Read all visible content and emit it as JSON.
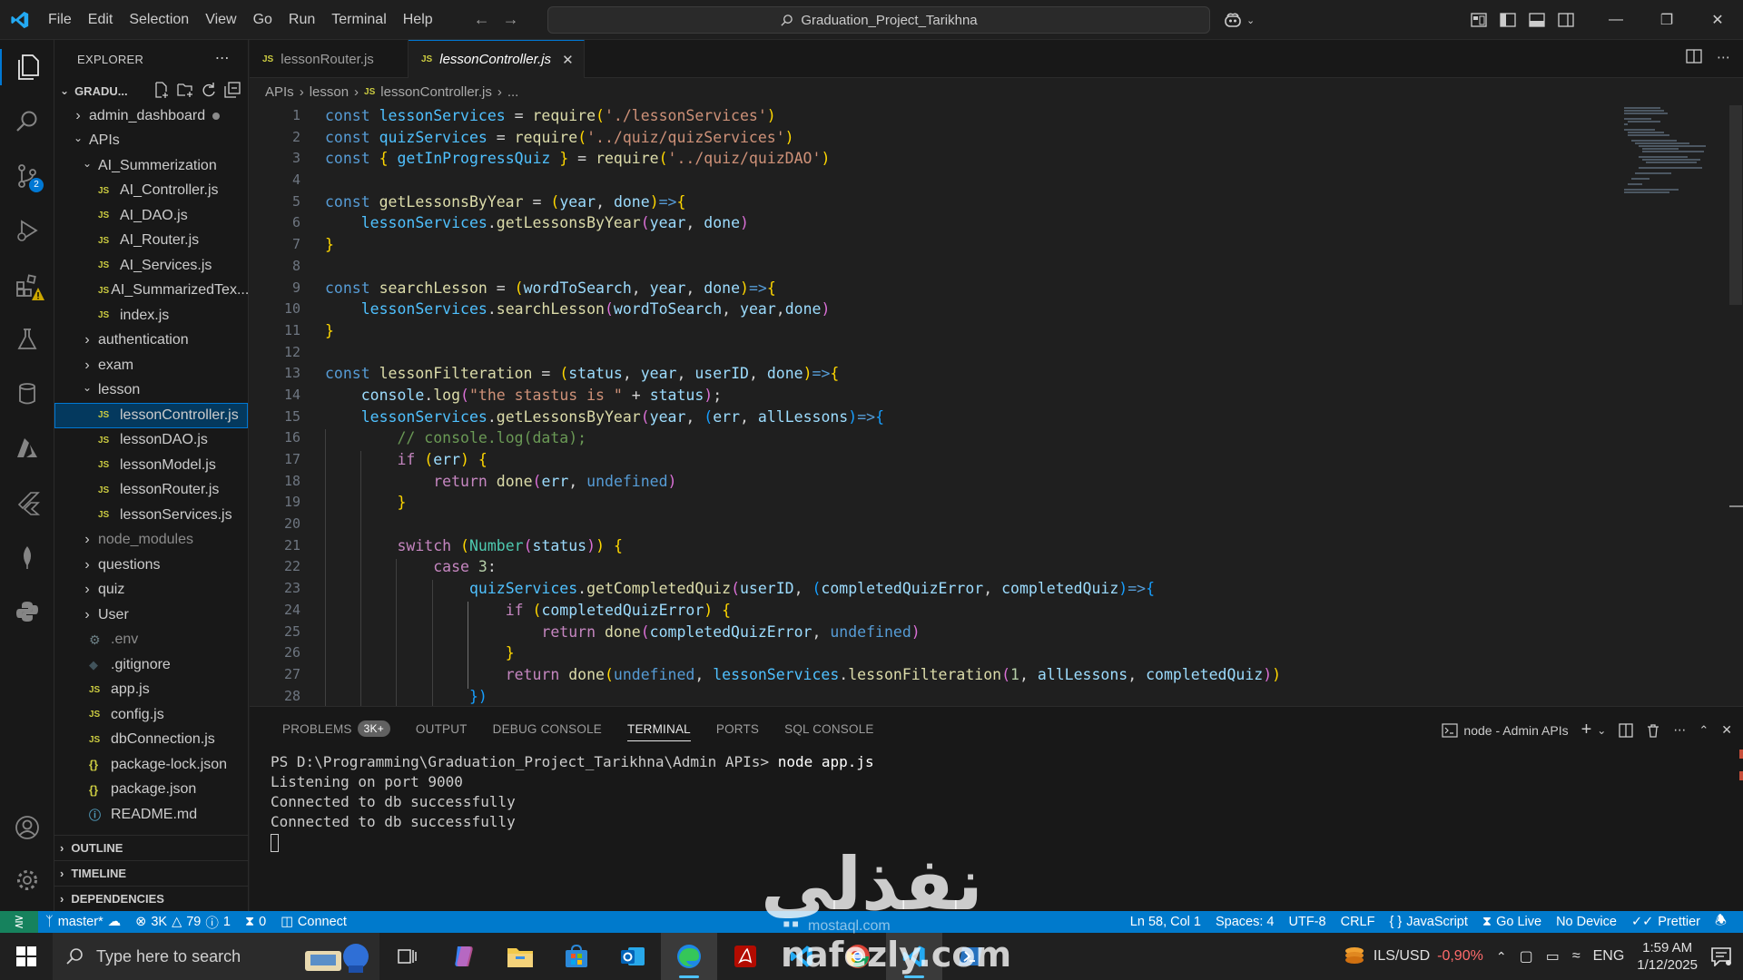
{
  "titlebar": {
    "menu": [
      "File",
      "Edit",
      "Selection",
      "View",
      "Go",
      "Run",
      "Terminal",
      "Help"
    ],
    "search_text": "Graduation_Project_Tarikhna"
  },
  "activity": {
    "source_control_badge": "2"
  },
  "sidebar": {
    "title": "EXPLORER",
    "root": "GRADU...",
    "tree": [
      {
        "label": "admin_dashboard",
        "kind": "folder",
        "depth": 0,
        "open": false,
        "dot": true
      },
      {
        "label": "APIs",
        "kind": "folder",
        "depth": 0,
        "open": true
      },
      {
        "label": "AI_Summerization",
        "kind": "folder",
        "depth": 1,
        "open": true
      },
      {
        "label": "AI_Controller.js",
        "kind": "js",
        "depth": 2
      },
      {
        "label": "AI_DAO.js",
        "kind": "js",
        "depth": 2
      },
      {
        "label": "AI_Router.js",
        "kind": "js",
        "depth": 2
      },
      {
        "label": "AI_Services.js",
        "kind": "js",
        "depth": 2
      },
      {
        "label": "AI_SummarizedTex...",
        "kind": "js",
        "depth": 2
      },
      {
        "label": "index.js",
        "kind": "js",
        "depth": 2
      },
      {
        "label": "authentication",
        "kind": "folder",
        "depth": 1,
        "open": false
      },
      {
        "label": "exam",
        "kind": "folder",
        "depth": 1,
        "open": false
      },
      {
        "label": "lesson",
        "kind": "folder",
        "depth": 1,
        "open": true
      },
      {
        "label": "lessonController.js",
        "kind": "js",
        "depth": 2,
        "selected": true
      },
      {
        "label": "lessonDAO.js",
        "kind": "js",
        "depth": 2
      },
      {
        "label": "lessonModel.js",
        "kind": "js",
        "depth": 2
      },
      {
        "label": "lessonRouter.js",
        "kind": "js",
        "depth": 2
      },
      {
        "label": "lessonServices.js",
        "kind": "js",
        "depth": 2
      },
      {
        "label": "node_modules",
        "kind": "folder",
        "depth": 1,
        "open": false,
        "dim": true
      },
      {
        "label": "questions",
        "kind": "folder",
        "depth": 1,
        "open": false
      },
      {
        "label": "quiz",
        "kind": "folder",
        "depth": 1,
        "open": false
      },
      {
        "label": "User",
        "kind": "folder",
        "depth": 1,
        "open": false
      },
      {
        "label": ".env",
        "kind": "gear",
        "depth": 1,
        "dim": true
      },
      {
        "label": ".gitignore",
        "kind": "git",
        "depth": 1
      },
      {
        "label": "app.js",
        "kind": "js",
        "depth": 1
      },
      {
        "label": "config.js",
        "kind": "js",
        "depth": 1
      },
      {
        "label": "dbConnection.js",
        "kind": "js",
        "depth": 1
      },
      {
        "label": "package-lock.json",
        "kind": "json",
        "depth": 1
      },
      {
        "label": "package.json",
        "kind": "json",
        "depth": 1
      },
      {
        "label": "README.md",
        "kind": "info",
        "depth": 1
      }
    ],
    "sections": [
      "OUTLINE",
      "TIMELINE",
      "DEPENDENCIES"
    ]
  },
  "tabs": [
    {
      "label": "lessonRouter.js",
      "active": false
    },
    {
      "label": "lessonController.js",
      "active": true
    }
  ],
  "breadcrumbs": [
    "APIs",
    "lesson",
    "lessonController.js",
    "..."
  ],
  "editor": {
    "line_numbers": [
      "1",
      "2",
      "3",
      "4",
      "5",
      "6",
      "7",
      "8",
      "9",
      "10",
      "11",
      "12",
      "13",
      "14",
      "15",
      "16",
      "17",
      "18",
      "19",
      "20",
      "21",
      "22",
      "23",
      "24",
      "25",
      "26",
      "27",
      "28"
    ]
  },
  "panel": {
    "tabs": [
      "PROBLEMS",
      "OUTPUT",
      "DEBUG CONSOLE",
      "TERMINAL",
      "PORTS",
      "SQL CONSOLE"
    ],
    "problems_count": "3K+",
    "active_tab": "TERMINAL",
    "terminal_name": "node - Admin APIs",
    "terminal_prompt": "PS D:\\Programming\\Graduation_Project_Tarikhna\\Admin APIs> ",
    "terminal_command": "node app.js",
    "terminal_output": [
      "Listening on port 9000",
      "Connected to db successfully",
      "Connected to db successfully"
    ]
  },
  "statusbar": {
    "branch": "master*",
    "errors": "3K",
    "warnings": "79",
    "info": "1",
    "ports": "0",
    "connect": "Connect",
    "position": "Ln 58, Col 1",
    "spaces": "Spaces: 4",
    "encoding": "UTF-8",
    "eol": "CRLF",
    "language": "JavaScript",
    "golive": "Go Live",
    "device": "No Device",
    "prettier": "Prettier"
  },
  "taskbar": {
    "search_placeholder": "Type here to search",
    "currency": "ILS/USD",
    "currency_change": "-0,90%",
    "lang": "ENG",
    "time": "1:59 AM",
    "date": "1/12/2025"
  },
  "watermark": {
    "text": "nafezly.com",
    "arabic": "نفذلي",
    "sub": "mostaql.com"
  },
  "colors": {
    "accent": "#0078d4",
    "statusbar": "#007acc",
    "remote": "#16825d"
  }
}
